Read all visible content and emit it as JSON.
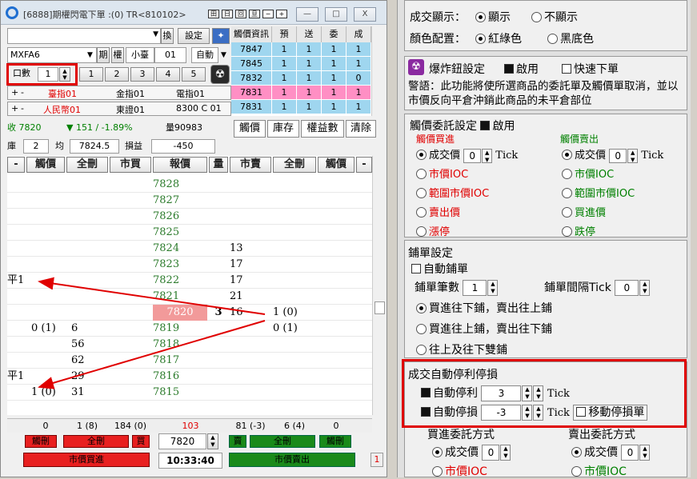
{
  "window": {
    "title": "[6888]期權閃電下單 :(0) TR<810102>",
    "icons": [
      "toolbar-icon-1",
      "toolbar-icon-2",
      "toolbar-icon-3",
      "toolbar-icon-4",
      "toolbar-icon-5",
      "toolbar-icon-6"
    ],
    "minimize": "—",
    "restore": "□",
    "close": "X"
  },
  "left_top": {
    "account_select": "",
    "switch_btn": "換",
    "settings_btn": "設定",
    "symbol": "MXFA6",
    "type_future": "期",
    "type_option": "權",
    "product_name": "小臺",
    "month": "01",
    "auto_label": "自動",
    "qty_label": "口數",
    "qty_value": "1",
    "presets": [
      "1",
      "2",
      "3",
      "4",
      "5"
    ],
    "indices": [
      {
        "sign1": "+",
        "sign2": "-",
        "name": "臺指01"
      },
      {
        "sign1": "",
        "sign2": "",
        "name": "金指01"
      },
      {
        "sign1": "",
        "sign2": "",
        "name": "電指01"
      }
    ],
    "indices2": [
      {
        "sign1": "+",
        "sign2": "-",
        "name": "人民幣01"
      },
      {
        "sign1": "",
        "sign2": "",
        "name": "東證01"
      },
      {
        "sign1": "",
        "sign2": "",
        "name": "8300 C 01"
      }
    ]
  },
  "quote_table": {
    "headers": [
      "觸價資訊",
      "預",
      "送",
      "委",
      "成"
    ],
    "rows": [
      {
        "price": "7847",
        "v": [
          "1",
          "1",
          "1",
          "1"
        ]
      },
      {
        "price": "7845",
        "v": [
          "1",
          "1",
          "1",
          "1"
        ]
      },
      {
        "price": "7832",
        "v": [
          "1",
          "1",
          "1",
          "0"
        ]
      },
      {
        "price": "7831",
        "v": [
          "1",
          "1",
          "1",
          "1"
        ]
      },
      {
        "price": "7831",
        "v": [
          "1",
          "1",
          "1",
          "1"
        ]
      }
    ]
  },
  "status": {
    "close": "收 7820",
    "change": "▼ 151 / -1.89%",
    "volume": "量90983",
    "buttons": [
      "觸價",
      "庫存",
      "權益數",
      "清除"
    ],
    "inventory_label": "庫",
    "inventory_value": "2",
    "avg_label": "均",
    "avg_value": "7824.5",
    "pl_label": "損益",
    "pl_value": "-450"
  },
  "ladder_header": [
    "-",
    "觸價",
    "全刪",
    "市買",
    "報價",
    "量",
    "市賣",
    "全刪",
    "觸價",
    "-"
  ],
  "ladder_rows": [
    {
      "l": "",
      "del": "",
      "buy": "",
      "price": "7828",
      "qty": "",
      "sell": "",
      "del2": "",
      "r": ""
    },
    {
      "l": "",
      "del": "",
      "buy": "",
      "price": "7827",
      "qty": "",
      "sell": "",
      "del2": "",
      "r": ""
    },
    {
      "l": "",
      "del": "",
      "buy": "",
      "price": "7826",
      "qty": "",
      "sell": "",
      "del2": "",
      "r": ""
    },
    {
      "l": "",
      "del": "",
      "buy": "",
      "price": "7825",
      "qty": "",
      "sell": "",
      "del2": "",
      "r": ""
    },
    {
      "l": "",
      "del": "",
      "buy": "",
      "price": "7824",
      "qty": "",
      "sell": "13",
      "del2": "",
      "r": ""
    },
    {
      "l": "",
      "del": "",
      "buy": "",
      "price": "7823",
      "qty": "",
      "sell": "17",
      "del2": "",
      "r": ""
    },
    {
      "l": "平1",
      "del": "",
      "buy": "",
      "price": "7822",
      "qty": "",
      "sell": "17",
      "del2": "",
      "r": ""
    },
    {
      "l": "",
      "del": "",
      "buy": "",
      "price": "7821",
      "qty": "",
      "sell": "21",
      "del2": "",
      "r": ""
    },
    {
      "l": "",
      "del": "",
      "buy": "",
      "price": "7820",
      "qty": "3",
      "sell": "16",
      "del2": "1 (0)",
      "r": ""
    },
    {
      "l": "",
      "del": "0 (1)",
      "buy": "6",
      "price": "7819",
      "qty": "",
      "sell": "",
      "del2": "0 (1)",
      "r": ""
    },
    {
      "l": "",
      "del": "",
      "buy": "56",
      "price": "7818",
      "qty": "",
      "sell": "",
      "del2": "",
      "r": ""
    },
    {
      "l": "",
      "del": "",
      "buy": "62",
      "price": "7817",
      "qty": "",
      "sell": "",
      "del2": "",
      "r": ""
    },
    {
      "l": "平1",
      "del": "",
      "buy": "29",
      "price": "7816",
      "qty": "",
      "sell": "",
      "del2": "",
      "r": ""
    },
    {
      "l": "",
      "del": "1 (0)",
      "buy": "31",
      "price": "7815",
      "qty": "",
      "sell": "",
      "del2": "",
      "r": ""
    }
  ],
  "footer": {
    "totals": [
      "0",
      "1 (8)",
      "184 (0)",
      "103",
      "81 (-3)",
      "6 (4)",
      "0"
    ],
    "touch_del_l": "觸刪",
    "all_del_l": "全刪",
    "buy_btn": "買",
    "price_input": "7820",
    "sell_btn": "賣",
    "all_del_r": "全刪",
    "touch_del_r": "觸刪",
    "market_buy": "市價買進",
    "time": "10:33:40",
    "market_sell": "市價賣出",
    "corner": "1"
  },
  "right": {
    "fill_display_label": "成交顯示：",
    "fill_display_opts": [
      "顯示",
      "不顯示"
    ],
    "color_label": "顏色配置：",
    "color_opts": [
      "紅綠色",
      "黑底色"
    ],
    "bomb_label": "爆炸鈕設定",
    "bomb_enable": "啟用",
    "fast_order": "快速下單",
    "warning": "警語：此功能將使所選商品的委託單及觸價單取消，並以市價反向平倉沖銷此商品的未平倉部位",
    "touch_title": "觸價委託設定",
    "touch_enable": "啟用",
    "touch_buy": "觸價買進",
    "touch_sell": "觸價賣出",
    "buy_opts": [
      "成交價",
      "市價IOC",
      "範圍市價IOC",
      "賣出價",
      "漲停"
    ],
    "sell_opts": [
      "成交價",
      "市價IOC",
      "範圍市價IOC",
      "買進價",
      "跌停"
    ],
    "tick_value": "0",
    "tick_unit": "Tick",
    "ladder_title": "鋪單設定",
    "auto_ladder": "自動鋪單",
    "ladder_count_label": "鋪單筆數",
    "ladder_count": "1",
    "ladder_gap_label": "鋪單間隔Tick",
    "ladder_gap": "0",
    "ladder_opts": [
      "買進往下鋪，賣出往上鋪",
      "買進往上鋪，賣出往下鋪",
      "往上及往下雙鋪"
    ],
    "auto_title": "成交自動停利停損",
    "take_profit_label": "自動停利",
    "take_profit": "3",
    "stop_loss_label": "自動停損",
    "stop_loss": "-3",
    "trailing": "移動停損單",
    "buy_method": "買進委託方式",
    "sell_method": "賣出委託方式",
    "method_opts": [
      "成交價",
      "市價IOC"
    ],
    "method_value": "0"
  },
  "colors": {
    "accent_red": "#e00000",
    "quote_blue": "#9fd6ef",
    "quote_pink": "#ff8fc4",
    "current_price_bg": "#f29a9a"
  }
}
